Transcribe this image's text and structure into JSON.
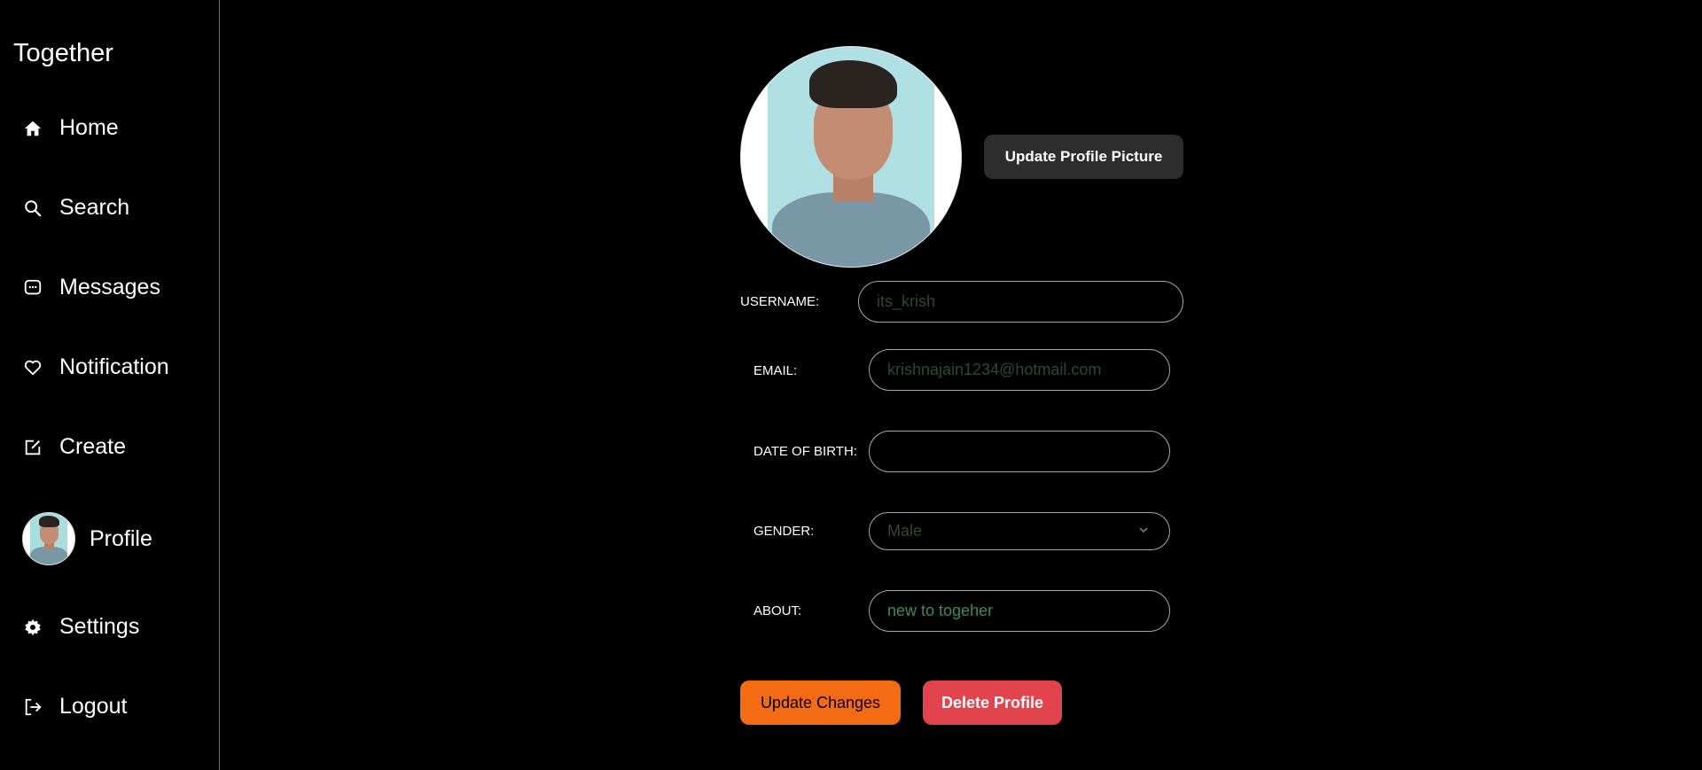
{
  "app": {
    "title": "Together"
  },
  "sidebar": {
    "items": [
      {
        "label": "Home",
        "icon": "home-icon"
      },
      {
        "label": "Search",
        "icon": "search-icon"
      },
      {
        "label": "Messages",
        "icon": "message-icon"
      },
      {
        "label": "Notification",
        "icon": "heart-icon"
      },
      {
        "label": "Create",
        "icon": "edit-icon"
      },
      {
        "label": "Profile",
        "icon": "avatar"
      },
      {
        "label": "Settings",
        "icon": "gear-icon"
      },
      {
        "label": "Logout",
        "icon": "logout-icon"
      }
    ]
  },
  "profile": {
    "update_picture_label": "Update Profile Picture",
    "fields": {
      "username": {
        "label": "USERNAME:",
        "placeholder": "its_krish"
      },
      "email": {
        "label": "EMAIL:",
        "placeholder": "krishnajain1234@hotmail.com"
      },
      "dob": {
        "label": "DATE OF BIRTH:",
        "value": ""
      },
      "gender": {
        "label": "GENDER:",
        "value": "Male"
      },
      "about": {
        "label": "ABOUT:",
        "value": "new to togeher"
      }
    },
    "update_changes_label": "Update Changes",
    "delete_profile_label": "Delete Profile"
  },
  "colors": {
    "background": "#000000",
    "orange": "#f46b12",
    "red": "#e2434c",
    "dark_button": "#2d2d2d"
  }
}
